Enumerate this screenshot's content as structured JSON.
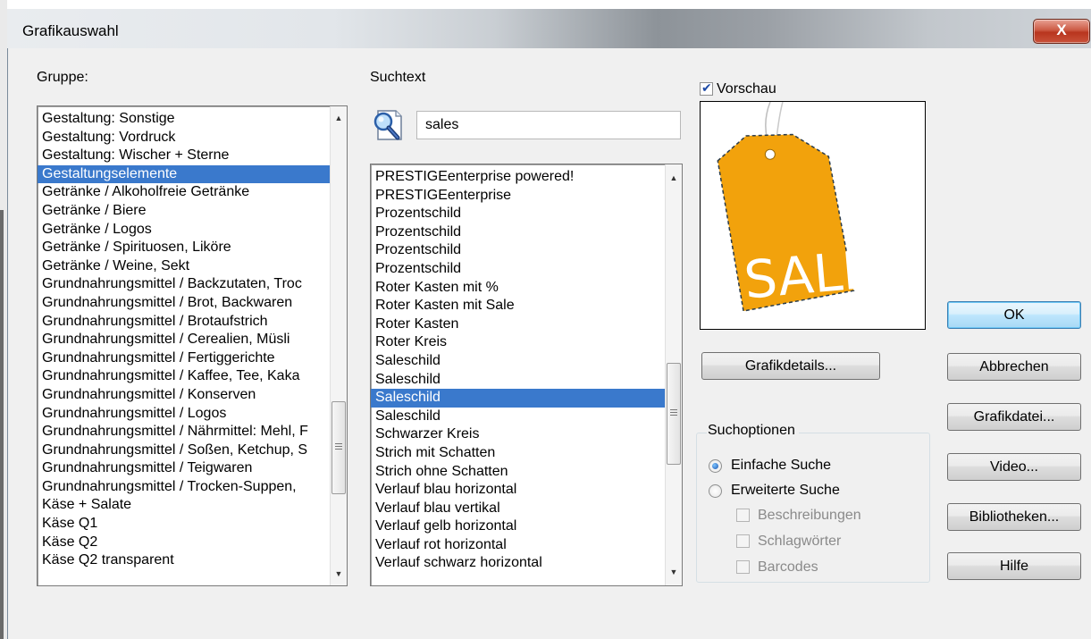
{
  "window": {
    "title": "Grafikauswahl",
    "close_label": "X"
  },
  "group": {
    "label": "Gruppe:",
    "items": [
      "Gestaltung: Sonstige",
      "Gestaltung: Vordruck",
      "Gestaltung: Wischer + Sterne",
      "Gestaltungselemente",
      "Getränke / Alkoholfreie Getränke",
      "Getränke / Biere",
      "Getränke / Logos",
      "Getränke / Spirituosen, Liköre",
      "Getränke / Weine, Sekt",
      "Grundnahrungsmittel / Backzutaten, Troc",
      "Grundnahrungsmittel / Brot, Backwaren",
      "Grundnahrungsmittel / Brotaufstrich",
      "Grundnahrungsmittel / Cerealien, Müsli",
      "Grundnahrungsmittel / Fertiggerichte",
      "Grundnahrungsmittel / Kaffee, Tee, Kaka",
      "Grundnahrungsmittel / Konserven",
      "Grundnahrungsmittel / Logos",
      "Grundnahrungsmittel / Nährmittel: Mehl, F",
      "Grundnahrungsmittel / Soßen, Ketchup, S",
      "Grundnahrungsmittel / Teigwaren",
      "Grundnahrungsmittel / Trocken-Suppen,",
      "Käse + Salate",
      "Käse Q1",
      "Käse Q2",
      "Käse Q2 transparent"
    ],
    "selected_index": 3
  },
  "search": {
    "label": "Suchtext",
    "value": "sales"
  },
  "results": {
    "items": [
      "PRESTIGEenterprise powered!",
      "PRESTIGEenterprise",
      "Prozentschild",
      "Prozentschild",
      "Prozentschild",
      "Prozentschild",
      "Roter Kasten mit %",
      "Roter Kasten mit Sale",
      "Roter Kasten",
      "Roter Kreis",
      "Saleschild",
      "Saleschild",
      "Saleschild",
      "Saleschild",
      "Schwarzer Kreis",
      "Strich mit Schatten",
      "Strich ohne Schatten",
      "Verlauf blau horizontal",
      "Verlauf blau vertikal",
      "Verlauf gelb horizontal",
      "Verlauf rot horizontal",
      "Verlauf schwarz horizontal"
    ],
    "selected_index": 12
  },
  "preview": {
    "checkbox_label": "Vorschau",
    "checked": true,
    "tag_text": "SALE",
    "tag_color": "#f2a20c"
  },
  "buttons": {
    "details": "Grafikdetails...",
    "ok": "OK",
    "cancel": "Abbrechen",
    "graphic_file": "Grafikdatei...",
    "video": "Video...",
    "libraries": "Bibliotheken...",
    "help": "Hilfe"
  },
  "search_options": {
    "title": "Suchoptionen",
    "simple": "Einfache Suche",
    "extended": "Erweiterte Suche",
    "descriptions": "Beschreibungen",
    "keywords": "Schlagwörter",
    "barcodes": "Barcodes"
  },
  "colors": {
    "selection": "#3a79cc",
    "dialog_bg": "#f0f0f0",
    "close_button": "#c9523a"
  },
  "icons": {
    "search": "magnifier-document-icon",
    "close": "close-icon"
  }
}
